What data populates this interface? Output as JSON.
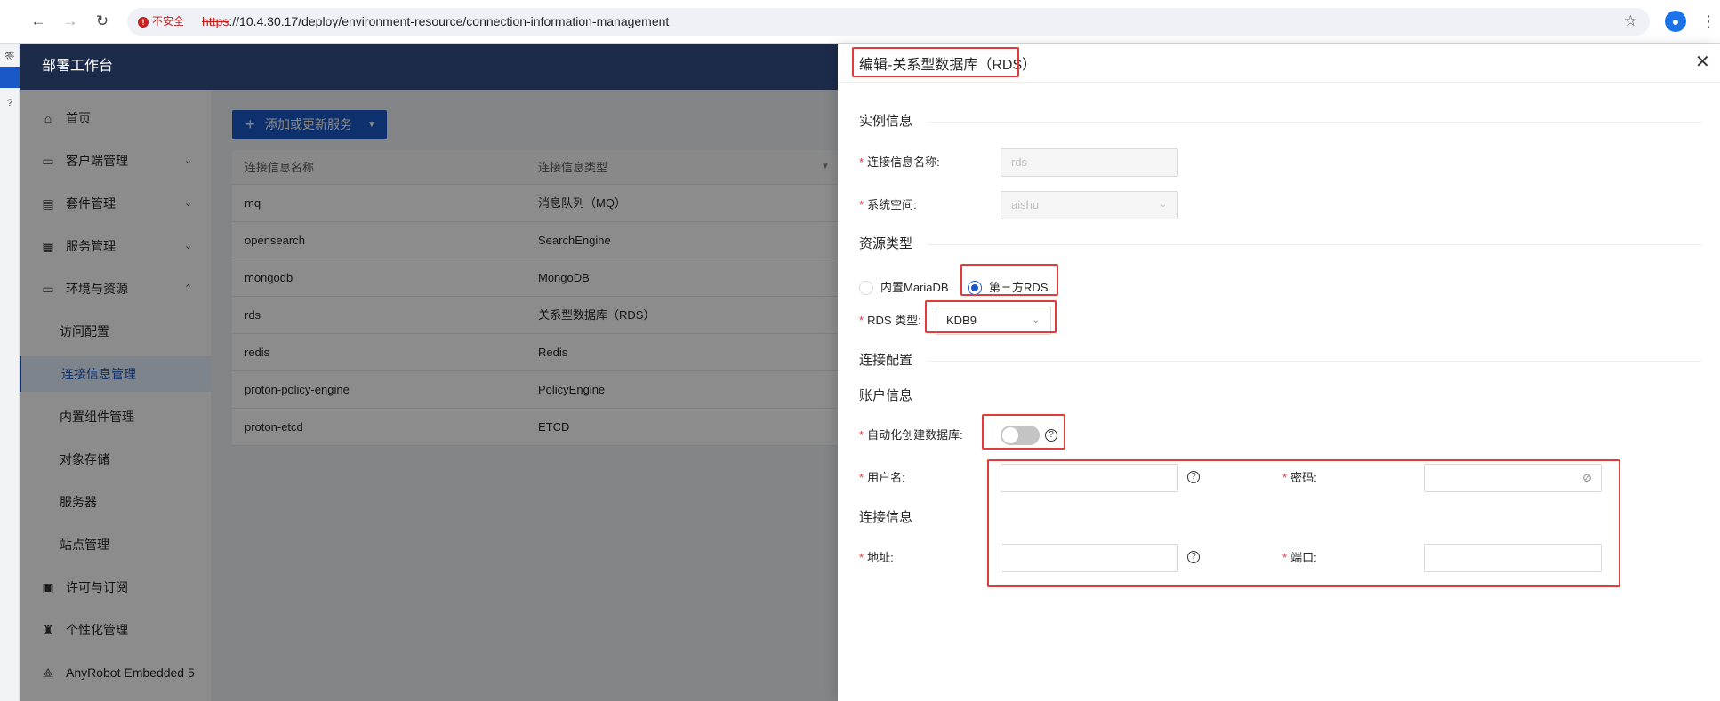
{
  "browser": {
    "insecure_label": "不安全",
    "url_scheme": "https",
    "url_rest": "://10.4.30.17/deploy/environment-resource/connection-information-management",
    "back_glyph": "←",
    "forward_glyph": "→",
    "reload_glyph": "↻",
    "star_glyph": "☆",
    "profile_glyph": "●",
    "menu_glyph": "⋮"
  },
  "left_sliver": {
    "items": [
      "签",
      "?"
    ]
  },
  "app": {
    "title": "部署工作台",
    "sidebar": [
      {
        "label": "首页",
        "icon": "home-icon",
        "glyph": "⌂"
      },
      {
        "label": "客户端管理",
        "icon": "client-icon",
        "glyph": "▭",
        "caret": "⌄"
      },
      {
        "label": "套件管理",
        "icon": "suite-icon",
        "glyph": "▤",
        "caret": "⌄"
      },
      {
        "label": "服务管理",
        "icon": "service-icon",
        "glyph": "▦",
        "caret": "⌄"
      },
      {
        "label": "环境与资源",
        "icon": "environment-icon",
        "glyph": "▭",
        "caret": "⌃"
      },
      {
        "label": "访问配置",
        "sub": true
      },
      {
        "label": "连接信息管理",
        "sub": true,
        "active": true
      },
      {
        "label": "内置组件管理",
        "sub": true
      },
      {
        "label": "对象存储",
        "sub": true
      },
      {
        "label": "服务器",
        "sub": true
      },
      {
        "label": "站点管理",
        "sub": true
      },
      {
        "label": "许可与订阅",
        "icon": "license-icon",
        "glyph": "▣"
      },
      {
        "label": "个性化管理",
        "icon": "shirt-icon",
        "glyph": "♜"
      },
      {
        "label": "AnyRobot Embedded 5",
        "icon": "anyrobot-icon",
        "glyph": "⟁"
      }
    ],
    "add_button": {
      "plus": "+",
      "label": "添加或更新服务",
      "caret": "▼"
    },
    "table": {
      "headers": [
        "连接信息名称",
        "连接信息类型"
      ],
      "filter_glyph": "▼",
      "rows": [
        {
          "name": "mq",
          "type": "消息队列（MQ）"
        },
        {
          "name": "opensearch",
          "type": "SearchEngine"
        },
        {
          "name": "mongodb",
          "type": "MongoDB"
        },
        {
          "name": "rds",
          "type": "关系型数据库（RDS）"
        },
        {
          "name": "redis",
          "type": "Redis"
        },
        {
          "name": "proton-policy-engine",
          "type": "PolicyEngine"
        },
        {
          "name": "proton-etcd",
          "type": "ETCD"
        }
      ]
    }
  },
  "drawer": {
    "title": "编辑-关系型数据库（RDS）",
    "close_glyph": "✕",
    "section_instance": "实例信息",
    "conn_name_label": "连接信息名称:",
    "conn_name_value": "rds",
    "namespace_label": "系统空间:",
    "namespace_value": "aishu",
    "section_resource": "资源类型",
    "radio_builtin": "内置MariaDB",
    "radio_thirdparty": "第三方RDS",
    "rds_type_label": "RDS 类型:",
    "rds_type_value": "KDB9",
    "section_connection": "连接配置",
    "section_account": "账户信息",
    "auto_create_label": "自动化创建数据库:",
    "username_label": "用户名:",
    "password_label": "密码:",
    "section_conninfo": "连接信息",
    "address_label": "地址:",
    "port_label": "端口:",
    "required_mark": "*",
    "help_glyph": "?",
    "select_arrow": "⌄",
    "eye_glyph": "⊘"
  }
}
